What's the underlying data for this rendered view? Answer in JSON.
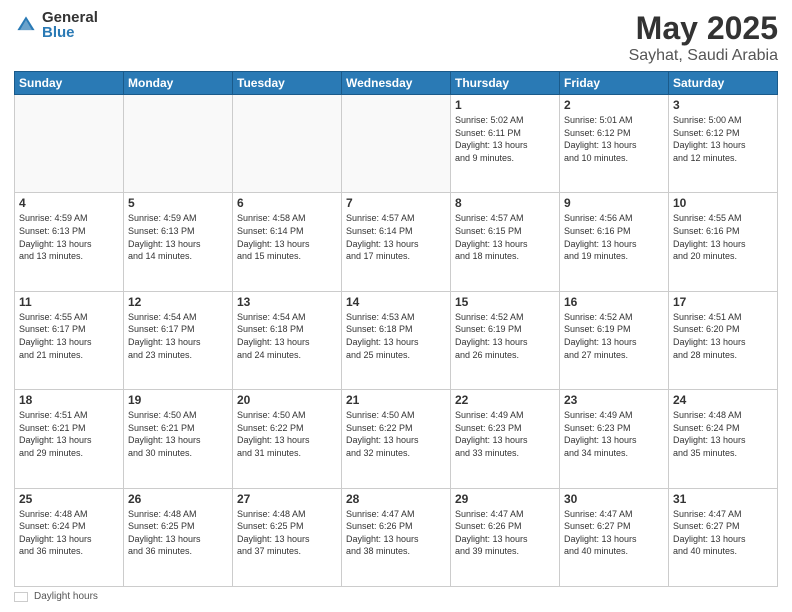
{
  "header": {
    "logo_general": "General",
    "logo_blue": "Blue",
    "title": "May 2025",
    "location": "Sayhat, Saudi Arabia"
  },
  "days_of_week": [
    "Sunday",
    "Monday",
    "Tuesday",
    "Wednesday",
    "Thursday",
    "Friday",
    "Saturday"
  ],
  "weeks": [
    [
      {
        "num": "",
        "info": ""
      },
      {
        "num": "",
        "info": ""
      },
      {
        "num": "",
        "info": ""
      },
      {
        "num": "",
        "info": ""
      },
      {
        "num": "1",
        "info": "Sunrise: 5:02 AM\nSunset: 6:11 PM\nDaylight: 13 hours\nand 9 minutes."
      },
      {
        "num": "2",
        "info": "Sunrise: 5:01 AM\nSunset: 6:12 PM\nDaylight: 13 hours\nand 10 minutes."
      },
      {
        "num": "3",
        "info": "Sunrise: 5:00 AM\nSunset: 6:12 PM\nDaylight: 13 hours\nand 12 minutes."
      }
    ],
    [
      {
        "num": "4",
        "info": "Sunrise: 4:59 AM\nSunset: 6:13 PM\nDaylight: 13 hours\nand 13 minutes."
      },
      {
        "num": "5",
        "info": "Sunrise: 4:59 AM\nSunset: 6:13 PM\nDaylight: 13 hours\nand 14 minutes."
      },
      {
        "num": "6",
        "info": "Sunrise: 4:58 AM\nSunset: 6:14 PM\nDaylight: 13 hours\nand 15 minutes."
      },
      {
        "num": "7",
        "info": "Sunrise: 4:57 AM\nSunset: 6:14 PM\nDaylight: 13 hours\nand 17 minutes."
      },
      {
        "num": "8",
        "info": "Sunrise: 4:57 AM\nSunset: 6:15 PM\nDaylight: 13 hours\nand 18 minutes."
      },
      {
        "num": "9",
        "info": "Sunrise: 4:56 AM\nSunset: 6:16 PM\nDaylight: 13 hours\nand 19 minutes."
      },
      {
        "num": "10",
        "info": "Sunrise: 4:55 AM\nSunset: 6:16 PM\nDaylight: 13 hours\nand 20 minutes."
      }
    ],
    [
      {
        "num": "11",
        "info": "Sunrise: 4:55 AM\nSunset: 6:17 PM\nDaylight: 13 hours\nand 21 minutes."
      },
      {
        "num": "12",
        "info": "Sunrise: 4:54 AM\nSunset: 6:17 PM\nDaylight: 13 hours\nand 23 minutes."
      },
      {
        "num": "13",
        "info": "Sunrise: 4:54 AM\nSunset: 6:18 PM\nDaylight: 13 hours\nand 24 minutes."
      },
      {
        "num": "14",
        "info": "Sunrise: 4:53 AM\nSunset: 6:18 PM\nDaylight: 13 hours\nand 25 minutes."
      },
      {
        "num": "15",
        "info": "Sunrise: 4:52 AM\nSunset: 6:19 PM\nDaylight: 13 hours\nand 26 minutes."
      },
      {
        "num": "16",
        "info": "Sunrise: 4:52 AM\nSunset: 6:19 PM\nDaylight: 13 hours\nand 27 minutes."
      },
      {
        "num": "17",
        "info": "Sunrise: 4:51 AM\nSunset: 6:20 PM\nDaylight: 13 hours\nand 28 minutes."
      }
    ],
    [
      {
        "num": "18",
        "info": "Sunrise: 4:51 AM\nSunset: 6:21 PM\nDaylight: 13 hours\nand 29 minutes."
      },
      {
        "num": "19",
        "info": "Sunrise: 4:50 AM\nSunset: 6:21 PM\nDaylight: 13 hours\nand 30 minutes."
      },
      {
        "num": "20",
        "info": "Sunrise: 4:50 AM\nSunset: 6:22 PM\nDaylight: 13 hours\nand 31 minutes."
      },
      {
        "num": "21",
        "info": "Sunrise: 4:50 AM\nSunset: 6:22 PM\nDaylight: 13 hours\nand 32 minutes."
      },
      {
        "num": "22",
        "info": "Sunrise: 4:49 AM\nSunset: 6:23 PM\nDaylight: 13 hours\nand 33 minutes."
      },
      {
        "num": "23",
        "info": "Sunrise: 4:49 AM\nSunset: 6:23 PM\nDaylight: 13 hours\nand 34 minutes."
      },
      {
        "num": "24",
        "info": "Sunrise: 4:48 AM\nSunset: 6:24 PM\nDaylight: 13 hours\nand 35 minutes."
      }
    ],
    [
      {
        "num": "25",
        "info": "Sunrise: 4:48 AM\nSunset: 6:24 PM\nDaylight: 13 hours\nand 36 minutes."
      },
      {
        "num": "26",
        "info": "Sunrise: 4:48 AM\nSunset: 6:25 PM\nDaylight: 13 hours\nand 36 minutes."
      },
      {
        "num": "27",
        "info": "Sunrise: 4:48 AM\nSunset: 6:25 PM\nDaylight: 13 hours\nand 37 minutes."
      },
      {
        "num": "28",
        "info": "Sunrise: 4:47 AM\nSunset: 6:26 PM\nDaylight: 13 hours\nand 38 minutes."
      },
      {
        "num": "29",
        "info": "Sunrise: 4:47 AM\nSunset: 6:26 PM\nDaylight: 13 hours\nand 39 minutes."
      },
      {
        "num": "30",
        "info": "Sunrise: 4:47 AM\nSunset: 6:27 PM\nDaylight: 13 hours\nand 40 minutes."
      },
      {
        "num": "31",
        "info": "Sunrise: 4:47 AM\nSunset: 6:27 PM\nDaylight: 13 hours\nand 40 minutes."
      }
    ]
  ],
  "footer": {
    "label": "Daylight hours"
  }
}
